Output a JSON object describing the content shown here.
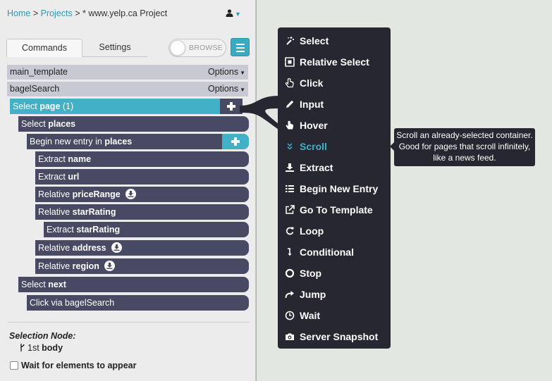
{
  "breadcrumb": {
    "home": "Home",
    "sep1": " > ",
    "projects": "Projects",
    "sep2": " > ",
    "current": "* www.yelp.ca Project"
  },
  "tabs": {
    "commands": "Commands",
    "settings": "Settings"
  },
  "toggle": {
    "label": "BROWSE"
  },
  "templates": [
    {
      "name": "main_template",
      "options": "Options"
    },
    {
      "name": "bagelSearch",
      "options": "Options"
    }
  ],
  "commands": {
    "c0": {
      "prefix": "Select ",
      "bold": "page",
      "suffix": " (1)"
    },
    "c1": {
      "prefix": "Select ",
      "bold": "places"
    },
    "c2": {
      "prefix": "Begin new entry in ",
      "bold": "places"
    },
    "c3": {
      "prefix": "Extract ",
      "bold": "name"
    },
    "c4": {
      "prefix": "Extract ",
      "bold": "url"
    },
    "c5": {
      "prefix": "Relative ",
      "bold": "priceRange"
    },
    "c6": {
      "prefix": "Relative ",
      "bold": "starRating"
    },
    "c7": {
      "prefix": "Extract ",
      "bold": "starRating"
    },
    "c8": {
      "prefix": "Relative ",
      "bold": "address"
    },
    "c9": {
      "prefix": "Relative ",
      "bold": "region"
    },
    "c10": {
      "prefix": "Select ",
      "bold": "next"
    },
    "c11": {
      "prefix": "Click via bagelSearch"
    }
  },
  "selection": {
    "title": "Selection Node:",
    "prefix": "1st ",
    "bold": "body"
  },
  "wait": {
    "label": "Wait for elements to appear"
  },
  "menu": [
    {
      "label": "Select",
      "icon": "magic-wand-icon"
    },
    {
      "label": "Relative Select",
      "icon": "relative-select-icon"
    },
    {
      "label": "Click",
      "icon": "pointer-hand-icon"
    },
    {
      "label": "Input",
      "icon": "pencil-icon"
    },
    {
      "label": "Hover",
      "icon": "hover-hand-icon"
    },
    {
      "label": "Scroll",
      "icon": "double-chevron-down-icon"
    },
    {
      "label": "Extract",
      "icon": "download-icon"
    },
    {
      "label": "Begin New Entry",
      "icon": "list-icon"
    },
    {
      "label": "Go To Template",
      "icon": "external-link-icon"
    },
    {
      "label": "Loop",
      "icon": "loop-icon"
    },
    {
      "label": "Conditional",
      "icon": "branch-arrow-icon"
    },
    {
      "label": "Stop",
      "icon": "stop-icon"
    },
    {
      "label": "Jump",
      "icon": "share-arrow-icon"
    },
    {
      "label": "Wait",
      "icon": "clock-icon"
    },
    {
      "label": "Server Snapshot",
      "icon": "camera-icon"
    }
  ],
  "tooltip": {
    "text": "Scroll an already-selected container. Good for pages that scroll infinitely, like a news feed."
  },
  "colors": {
    "accent": "#42b1c7",
    "command": "#474a62",
    "popup": "#262730"
  }
}
